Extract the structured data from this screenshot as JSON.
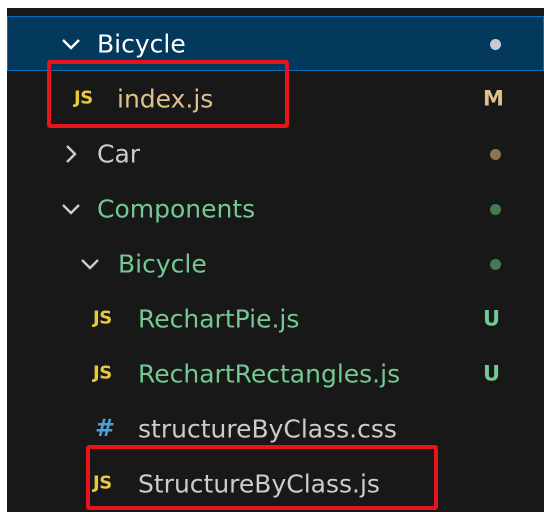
{
  "colors": {
    "tree_background": "#181818",
    "selected_row": "#04395e",
    "modified": "#e2c08d",
    "untracked": "#73c991",
    "default_text": "#cccccc",
    "highlight_box": "#e8141b"
  },
  "tree": {
    "rows": [
      {
        "label": "Bicycle",
        "kind": "folder",
        "expanded": true,
        "selected": true,
        "icon": "chevron-down-icon",
        "status": ""
      },
      {
        "label": "index.js",
        "kind": "file",
        "icon": "js-file-icon",
        "icon_text": "JS",
        "status": "M"
      },
      {
        "label": "Car",
        "kind": "folder",
        "expanded": false,
        "icon": "chevron-right-icon",
        "status": ""
      },
      {
        "label": "Components",
        "kind": "folder",
        "expanded": true,
        "icon": "chevron-down-icon",
        "status": ""
      },
      {
        "label": "Bicycle",
        "kind": "folder",
        "expanded": true,
        "icon": "chevron-down-icon",
        "status": ""
      },
      {
        "label": "RechartPie.js",
        "kind": "file",
        "icon": "js-file-icon",
        "icon_text": "JS",
        "status": "U"
      },
      {
        "label": "RechartRectangles.js",
        "kind": "file",
        "icon": "js-file-icon",
        "icon_text": "JS",
        "status": "U"
      },
      {
        "label": "structureByClass.css",
        "kind": "file",
        "icon": "css-file-icon",
        "icon_text": "#",
        "status": ""
      },
      {
        "label": "StructureByClass.js",
        "kind": "file",
        "icon": "js-file-icon",
        "icon_text": "JS",
        "status": ""
      }
    ]
  }
}
